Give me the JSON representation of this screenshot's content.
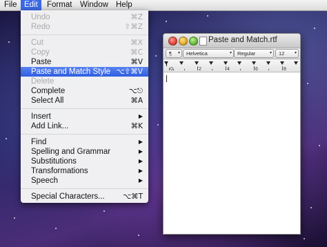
{
  "menubar": {
    "items": [
      {
        "label": "File"
      },
      {
        "label": "Edit"
      },
      {
        "label": "Format"
      },
      {
        "label": "Window"
      },
      {
        "label": "Help"
      }
    ]
  },
  "edit_menu": {
    "items": [
      {
        "label": "Undo",
        "shortcut": "⌘Z",
        "disabled": true
      },
      {
        "label": "Redo",
        "shortcut": "⇧⌘Z",
        "disabled": true
      },
      {
        "label": "Cut",
        "shortcut": "⌘X",
        "disabled": true
      },
      {
        "label": "Copy",
        "shortcut": "⌘C",
        "disabled": true
      },
      {
        "label": "Paste",
        "shortcut": "⌘V"
      },
      {
        "label": "Paste and Match Style",
        "shortcut": "⌥⇧⌘V",
        "highlighted": true
      },
      {
        "label": "Delete",
        "disabled": true
      },
      {
        "label": "Complete",
        "shortcut": "⌥⎋"
      },
      {
        "label": "Select All",
        "shortcut": "⌘A"
      },
      {
        "label": "Insert",
        "submenu": true
      },
      {
        "label": "Add Link...",
        "shortcut": "⌘K"
      },
      {
        "label": "Find",
        "submenu": true
      },
      {
        "label": "Spelling and Grammar",
        "submenu": true
      },
      {
        "label": "Substitutions",
        "submenu": true
      },
      {
        "label": "Transformations",
        "submenu": true
      },
      {
        "label": "Speech",
        "submenu": true
      },
      {
        "label": "Special Characters...",
        "shortcut": "⌥⌘T"
      }
    ]
  },
  "window": {
    "title": "Paste and Match.rtf",
    "toolbar": {
      "paragraph_style": "¶",
      "font_family": "Helvetica",
      "typeface": "Regular",
      "font_size": "12"
    },
    "ruler_numbers": [
      "0",
      "2",
      "4",
      "6",
      "8"
    ]
  },
  "colors": {
    "highlight": "#3c69e7",
    "menu_bg": "#f6f6f6",
    "disabled_text": "#a9a9a9"
  }
}
